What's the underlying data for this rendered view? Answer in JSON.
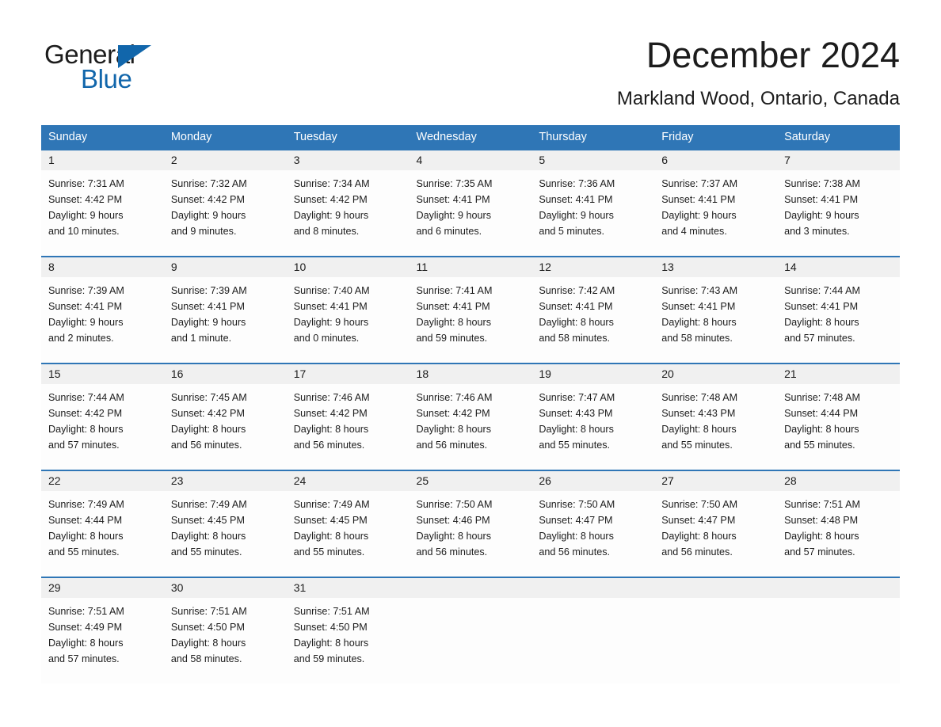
{
  "brand": {
    "name_part1": "General",
    "name_part2": "Blue",
    "triangle_icon": "triangle-icon",
    "accent_color": "#1166ab"
  },
  "header": {
    "month_title": "December 2024",
    "location": "Markland Wood, Ontario, Canada"
  },
  "calendar": {
    "header_bg": "#2f76b6",
    "daynum_bg": "#f0f0f0",
    "day_names": [
      "Sunday",
      "Monday",
      "Tuesday",
      "Wednesday",
      "Thursday",
      "Friday",
      "Saturday"
    ],
    "weeks": [
      {
        "days": [
          {
            "num": "1",
            "sunrise": "Sunrise: 7:31 AM",
            "sunset": "Sunset: 4:42 PM",
            "daylight_1": "Daylight: 9 hours",
            "daylight_2": "and 10 minutes."
          },
          {
            "num": "2",
            "sunrise": "Sunrise: 7:32 AM",
            "sunset": "Sunset: 4:42 PM",
            "daylight_1": "Daylight: 9 hours",
            "daylight_2": "and 9 minutes."
          },
          {
            "num": "3",
            "sunrise": "Sunrise: 7:34 AM",
            "sunset": "Sunset: 4:42 PM",
            "daylight_1": "Daylight: 9 hours",
            "daylight_2": "and 8 minutes."
          },
          {
            "num": "4",
            "sunrise": "Sunrise: 7:35 AM",
            "sunset": "Sunset: 4:41 PM",
            "daylight_1": "Daylight: 9 hours",
            "daylight_2": "and 6 minutes."
          },
          {
            "num": "5",
            "sunrise": "Sunrise: 7:36 AM",
            "sunset": "Sunset: 4:41 PM",
            "daylight_1": "Daylight: 9 hours",
            "daylight_2": "and 5 minutes."
          },
          {
            "num": "6",
            "sunrise": "Sunrise: 7:37 AM",
            "sunset": "Sunset: 4:41 PM",
            "daylight_1": "Daylight: 9 hours",
            "daylight_2": "and 4 minutes."
          },
          {
            "num": "7",
            "sunrise": "Sunrise: 7:38 AM",
            "sunset": "Sunset: 4:41 PM",
            "daylight_1": "Daylight: 9 hours",
            "daylight_2": "and 3 minutes."
          }
        ]
      },
      {
        "days": [
          {
            "num": "8",
            "sunrise": "Sunrise: 7:39 AM",
            "sunset": "Sunset: 4:41 PM",
            "daylight_1": "Daylight: 9 hours",
            "daylight_2": "and 2 minutes."
          },
          {
            "num": "9",
            "sunrise": "Sunrise: 7:39 AM",
            "sunset": "Sunset: 4:41 PM",
            "daylight_1": "Daylight: 9 hours",
            "daylight_2": "and 1 minute."
          },
          {
            "num": "10",
            "sunrise": "Sunrise: 7:40 AM",
            "sunset": "Sunset: 4:41 PM",
            "daylight_1": "Daylight: 9 hours",
            "daylight_2": "and 0 minutes."
          },
          {
            "num": "11",
            "sunrise": "Sunrise: 7:41 AM",
            "sunset": "Sunset: 4:41 PM",
            "daylight_1": "Daylight: 8 hours",
            "daylight_2": "and 59 minutes."
          },
          {
            "num": "12",
            "sunrise": "Sunrise: 7:42 AM",
            "sunset": "Sunset: 4:41 PM",
            "daylight_1": "Daylight: 8 hours",
            "daylight_2": "and 58 minutes."
          },
          {
            "num": "13",
            "sunrise": "Sunrise: 7:43 AM",
            "sunset": "Sunset: 4:41 PM",
            "daylight_1": "Daylight: 8 hours",
            "daylight_2": "and 58 minutes."
          },
          {
            "num": "14",
            "sunrise": "Sunrise: 7:44 AM",
            "sunset": "Sunset: 4:41 PM",
            "daylight_1": "Daylight: 8 hours",
            "daylight_2": "and 57 minutes."
          }
        ]
      },
      {
        "days": [
          {
            "num": "15",
            "sunrise": "Sunrise: 7:44 AM",
            "sunset": "Sunset: 4:42 PM",
            "daylight_1": "Daylight: 8 hours",
            "daylight_2": "and 57 minutes."
          },
          {
            "num": "16",
            "sunrise": "Sunrise: 7:45 AM",
            "sunset": "Sunset: 4:42 PM",
            "daylight_1": "Daylight: 8 hours",
            "daylight_2": "and 56 minutes."
          },
          {
            "num": "17",
            "sunrise": "Sunrise: 7:46 AM",
            "sunset": "Sunset: 4:42 PM",
            "daylight_1": "Daylight: 8 hours",
            "daylight_2": "and 56 minutes."
          },
          {
            "num": "18",
            "sunrise": "Sunrise: 7:46 AM",
            "sunset": "Sunset: 4:42 PM",
            "daylight_1": "Daylight: 8 hours",
            "daylight_2": "and 56 minutes."
          },
          {
            "num": "19",
            "sunrise": "Sunrise: 7:47 AM",
            "sunset": "Sunset: 4:43 PM",
            "daylight_1": "Daylight: 8 hours",
            "daylight_2": "and 55 minutes."
          },
          {
            "num": "20",
            "sunrise": "Sunrise: 7:48 AM",
            "sunset": "Sunset: 4:43 PM",
            "daylight_1": "Daylight: 8 hours",
            "daylight_2": "and 55 minutes."
          },
          {
            "num": "21",
            "sunrise": "Sunrise: 7:48 AM",
            "sunset": "Sunset: 4:44 PM",
            "daylight_1": "Daylight: 8 hours",
            "daylight_2": "and 55 minutes."
          }
        ]
      },
      {
        "days": [
          {
            "num": "22",
            "sunrise": "Sunrise: 7:49 AM",
            "sunset": "Sunset: 4:44 PM",
            "daylight_1": "Daylight: 8 hours",
            "daylight_2": "and 55 minutes."
          },
          {
            "num": "23",
            "sunrise": "Sunrise: 7:49 AM",
            "sunset": "Sunset: 4:45 PM",
            "daylight_1": "Daylight: 8 hours",
            "daylight_2": "and 55 minutes."
          },
          {
            "num": "24",
            "sunrise": "Sunrise: 7:49 AM",
            "sunset": "Sunset: 4:45 PM",
            "daylight_1": "Daylight: 8 hours",
            "daylight_2": "and 55 minutes."
          },
          {
            "num": "25",
            "sunrise": "Sunrise: 7:50 AM",
            "sunset": "Sunset: 4:46 PM",
            "daylight_1": "Daylight: 8 hours",
            "daylight_2": "and 56 minutes."
          },
          {
            "num": "26",
            "sunrise": "Sunrise: 7:50 AM",
            "sunset": "Sunset: 4:47 PM",
            "daylight_1": "Daylight: 8 hours",
            "daylight_2": "and 56 minutes."
          },
          {
            "num": "27",
            "sunrise": "Sunrise: 7:50 AM",
            "sunset": "Sunset: 4:47 PM",
            "daylight_1": "Daylight: 8 hours",
            "daylight_2": "and 56 minutes."
          },
          {
            "num": "28",
            "sunrise": "Sunrise: 7:51 AM",
            "sunset": "Sunset: 4:48 PM",
            "daylight_1": "Daylight: 8 hours",
            "daylight_2": "and 57 minutes."
          }
        ]
      },
      {
        "days": [
          {
            "num": "29",
            "sunrise": "Sunrise: 7:51 AM",
            "sunset": "Sunset: 4:49 PM",
            "daylight_1": "Daylight: 8 hours",
            "daylight_2": "and 57 minutes."
          },
          {
            "num": "30",
            "sunrise": "Sunrise: 7:51 AM",
            "sunset": "Sunset: 4:50 PM",
            "daylight_1": "Daylight: 8 hours",
            "daylight_2": "and 58 minutes."
          },
          {
            "num": "31",
            "sunrise": "Sunrise: 7:51 AM",
            "sunset": "Sunset: 4:50 PM",
            "daylight_1": "Daylight: 8 hours",
            "daylight_2": "and 59 minutes."
          },
          {
            "num": "",
            "sunrise": "",
            "sunset": "",
            "daylight_1": "",
            "daylight_2": ""
          },
          {
            "num": "",
            "sunrise": "",
            "sunset": "",
            "daylight_1": "",
            "daylight_2": ""
          },
          {
            "num": "",
            "sunrise": "",
            "sunset": "",
            "daylight_1": "",
            "daylight_2": ""
          },
          {
            "num": "",
            "sunrise": "",
            "sunset": "",
            "daylight_1": "",
            "daylight_2": ""
          }
        ]
      }
    ]
  }
}
